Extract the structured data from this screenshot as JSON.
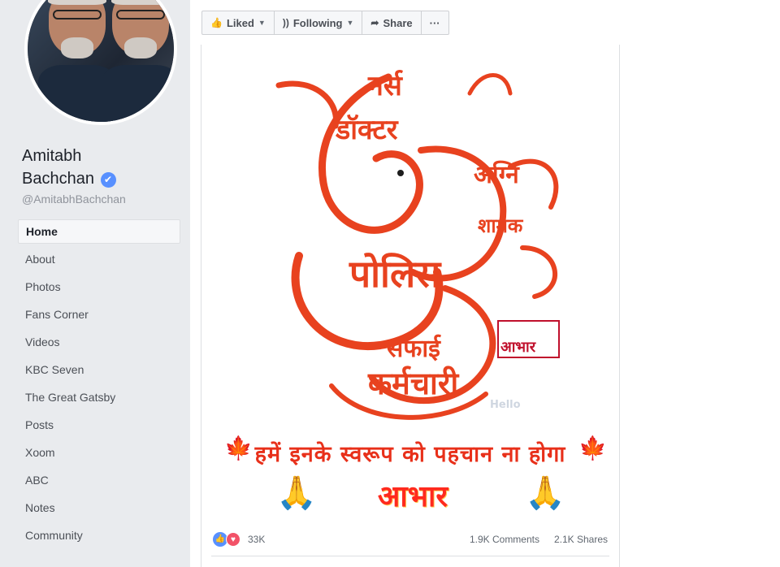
{
  "profile": {
    "name_line1": "Amitabh",
    "name_line2": "Bachchan",
    "verified_glyph": "✔",
    "handle": "@AmitabhBachchan"
  },
  "nav": {
    "items": [
      {
        "label": "Home",
        "active": true
      },
      {
        "label": "About"
      },
      {
        "label": "Photos"
      },
      {
        "label": "Fans Corner"
      },
      {
        "label": "Videos"
      },
      {
        "label": "KBC Seven"
      },
      {
        "label": "The Great Gatsby"
      },
      {
        "label": "Posts"
      },
      {
        "label": "Xoom"
      },
      {
        "label": "ABC"
      },
      {
        "label": "Notes"
      },
      {
        "label": "Community"
      }
    ]
  },
  "actionbar": {
    "liked": {
      "label": "Liked",
      "icon": "thumbs-up-icon",
      "glyph": "👍"
    },
    "following": {
      "label": "Following",
      "icon": "rss-icon",
      "glyph": "))"
    },
    "share": {
      "label": "Share",
      "icon": "share-arrow-icon",
      "glyph": "➦"
    },
    "more": {
      "label": "···",
      "icon": "more-icon"
    }
  },
  "post": {
    "image_text": {
      "word1": "नर्स",
      "word2": "डॉक्टर",
      "word3": "अग्नि",
      "word4": "शामक",
      "word5": "पोलिस",
      "word6": "सफाई",
      "word7": "कर्मचारी",
      "badge": "आभार",
      "slogan": "हमें इनके स्वरूप को पहचान ना होगा",
      "thanks": "आभार",
      "leaf_glyph": "🍁",
      "hands_glyph": "🙏",
      "watermark": "Hello"
    },
    "reactions": {
      "like_glyph": "👍",
      "love_glyph": "♥",
      "count": "33K"
    },
    "comments": "1.9K Comments",
    "shares": "2.1K Shares"
  },
  "colors": {
    "sidebar_bg": "#e9ebee",
    "accent_blue": "#5890ff",
    "calligraphy_red": "#e8421f"
  }
}
